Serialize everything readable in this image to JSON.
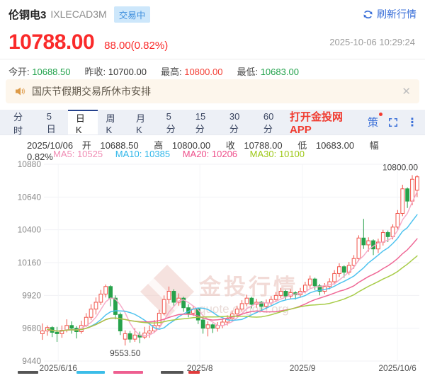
{
  "header": {
    "title": "伦铜电3",
    "code": "IXLECAD3M",
    "status": "交易中",
    "refresh_label": "刷新行情",
    "price": "10788.00",
    "change": "88.00(0.82%)",
    "timestamp": "2025-10-06 10:29:24"
  },
  "stats": [
    {
      "label": "今开:",
      "value": "10688.50",
      "tone": "green"
    },
    {
      "label": "昨收:",
      "value": "10700.00",
      "tone": "dark"
    },
    {
      "label": "最高:",
      "value": "10800.00",
      "tone": "red"
    },
    {
      "label": "最低:",
      "value": "10683.00",
      "tone": "green"
    }
  ],
  "notice": {
    "text": "国庆节假期交易所休市安排",
    "close_glyph": "✕"
  },
  "toolbar": {
    "tabs": [
      "分时",
      "5日",
      "日K",
      "周K",
      "月K",
      "5分",
      "15分",
      "30分",
      "60分"
    ],
    "active_tab": "日K",
    "app_link": "打开金投网APP",
    "strategy": "策",
    "more_glyph": "⋮"
  },
  "chart_header": {
    "date": "2025/10/06",
    "pairs": [
      {
        "k": "开",
        "v": "10688.50"
      },
      {
        "k": "高",
        "v": "10800.00"
      },
      {
        "k": "收",
        "v": "10788.00"
      },
      {
        "k": "低",
        "v": "10683.00"
      },
      {
        "k": "幅",
        "v": "0.82%"
      }
    ]
  },
  "ma_legend": [
    {
      "text": "MA5: 10525",
      "color": "#f08cb4"
    },
    {
      "text": "MA10: 10385",
      "color": "#2eb6e9"
    },
    {
      "text": "MA20: 10206",
      "color": "#ee4f8b"
    },
    {
      "text": "MA30: 10100",
      "color": "#9cc714"
    }
  ],
  "chart_data": {
    "type": "candlestick",
    "instrument": "伦铜电3 IXLECAD3M",
    "timeframe": "日K",
    "y_ticks": [
      10880,
      10640,
      10400,
      10160,
      9920,
      9680,
      9440
    ],
    "x_labels": [
      {
        "text": "2025/6/16",
        "i": 3.6
      },
      {
        "text": "2025/8",
        "i": 32.7
      },
      {
        "text": "2025/9",
        "i": 53.8
      },
      {
        "text": "2025/10/6",
        "i": 73.3
      }
    ],
    "colors": {
      "up": "#f1544b",
      "down": "#27a24b"
    },
    "ma_lines": [
      {
        "period": 5,
        "color": "#f6a9c8"
      },
      {
        "period": 10,
        "color": "#46c0ee"
      },
      {
        "period": 20,
        "color": "#ee6090"
      },
      {
        "period": 30,
        "color": "#a3c93f"
      }
    ],
    "annotations": [
      {
        "text": "10800.00",
        "i": 77,
        "price": 10800,
        "type": "high"
      },
      {
        "text": "9553.50",
        "i": 17,
        "price": 9553.5,
        "type": "low"
      }
    ],
    "watermark": {
      "brand": "金投行情",
      "url": "quote.cngold.org"
    },
    "candles": [
      [
        9640,
        9715,
        9595,
        9660
      ],
      [
        9660,
        9700,
        9625,
        9685
      ],
      [
        9685,
        9695,
        9615,
        9650
      ],
      [
        9650,
        9690,
        9580,
        9640
      ],
      [
        9640,
        9700,
        9610,
        9665
      ],
      [
        9665,
        9745,
        9650,
        9700
      ],
      [
        9700,
        9730,
        9640,
        9680
      ],
      [
        9680,
        9695,
        9605,
        9655
      ],
      [
        9655,
        9735,
        9640,
        9700
      ],
      [
        9700,
        9790,
        9690,
        9760
      ],
      [
        9760,
        9855,
        9740,
        9820
      ],
      [
        9820,
        9905,
        9780,
        9870
      ],
      [
        9870,
        9960,
        9850,
        9930
      ],
      [
        9930,
        10000,
        9905,
        9985
      ],
      [
        9985,
        9995,
        9840,
        9900
      ],
      [
        9900,
        9920,
        9745,
        9780
      ],
      [
        9780,
        9795,
        9630,
        9660
      ],
      [
        9600,
        9665,
        9553.5,
        9640
      ],
      [
        9640,
        9660,
        9575,
        9600
      ],
      [
        9600,
        9680,
        9580,
        9630
      ],
      [
        9630,
        9655,
        9570,
        9615
      ],
      [
        9615,
        9690,
        9600,
        9645
      ],
      [
        9645,
        9700,
        9610,
        9660
      ],
      [
        9660,
        9740,
        9645,
        9700
      ],
      [
        9700,
        9815,
        9690,
        9790
      ],
      [
        9790,
        9920,
        9775,
        9890
      ],
      [
        9890,
        9985,
        9860,
        9950
      ],
      [
        9950,
        9965,
        9840,
        9870
      ],
      [
        9870,
        9935,
        9845,
        9900
      ],
      [
        9900,
        9910,
        9800,
        9830
      ],
      [
        9830,
        9855,
        9760,
        9790
      ],
      [
        9790,
        9845,
        9770,
        9820
      ],
      [
        9820,
        9830,
        9710,
        9740
      ],
      [
        9740,
        9755,
        9640,
        9680
      ],
      [
        9680,
        9730,
        9620,
        9705
      ],
      [
        9705,
        9715,
        9645,
        9680
      ],
      [
        9680,
        9725,
        9655,
        9700
      ],
      [
        9700,
        9750,
        9680,
        9725
      ],
      [
        9725,
        9775,
        9700,
        9750
      ],
      [
        9750,
        9810,
        9730,
        9785
      ],
      [
        9785,
        9845,
        9760,
        9820
      ],
      [
        9820,
        9885,
        9800,
        9860
      ],
      [
        9860,
        9925,
        9840,
        9900
      ],
      [
        9900,
        9910,
        9825,
        9855
      ],
      [
        9855,
        9895,
        9830,
        9870
      ],
      [
        9870,
        9880,
        9805,
        9840
      ],
      [
        9840,
        9890,
        9820,
        9865
      ],
      [
        9865,
        9915,
        9845,
        9890
      ],
      [
        9890,
        9945,
        9870,
        9920
      ],
      [
        9920,
        9975,
        9900,
        9950
      ],
      [
        9950,
        9960,
        9885,
        9915
      ],
      [
        9915,
        9965,
        9895,
        9940
      ],
      [
        9940,
        9950,
        9890,
        9925
      ],
      [
        9925,
        9975,
        9905,
        9950
      ],
      [
        9950,
        10020,
        9935,
        9995
      ],
      [
        9995,
        10065,
        9975,
        10040
      ],
      [
        10040,
        10050,
        9960,
        9990
      ],
      [
        9990,
        10005,
        9920,
        9950
      ],
      [
        9950,
        10010,
        9930,
        9985
      ],
      [
        9985,
        10045,
        9965,
        10020
      ],
      [
        10020,
        10105,
        10000,
        10080
      ],
      [
        10080,
        10155,
        10055,
        10130
      ],
      [
        10130,
        10140,
        10050,
        10090
      ],
      [
        10090,
        10165,
        10070,
        10140
      ],
      [
        10140,
        10215,
        10115,
        10190
      ],
      [
        10190,
        10360,
        10170,
        10340
      ],
      [
        10340,
        10480,
        10260,
        10290
      ],
      [
        10290,
        10345,
        10240,
        10320
      ],
      [
        10320,
        10330,
        10215,
        10260
      ],
      [
        10260,
        10335,
        10230,
        10310
      ],
      [
        10310,
        10400,
        10285,
        10380
      ],
      [
        10380,
        10395,
        10310,
        10350
      ],
      [
        10350,
        10440,
        10330,
        10420
      ],
      [
        10420,
        10545,
        10400,
        10520
      ],
      [
        10520,
        10730,
        10500,
        10700
      ],
      [
        10700,
        10710,
        10560,
        10610
      ],
      [
        10610,
        10800,
        10580,
        10770
      ],
      [
        10690,
        10800,
        10640,
        10788
      ]
    ]
  },
  "theme": {
    "price_red": "#fa2a2a",
    "up_red": "#f1544b",
    "down_green": "#27a24b",
    "link_blue": "#3a6fd8",
    "badge_blue_bg": "#cde7fb",
    "notice_bg": "#fdf6ec",
    "tabbar_bg": "#edf0f6",
    "app_link_red": "#f03b30"
  }
}
